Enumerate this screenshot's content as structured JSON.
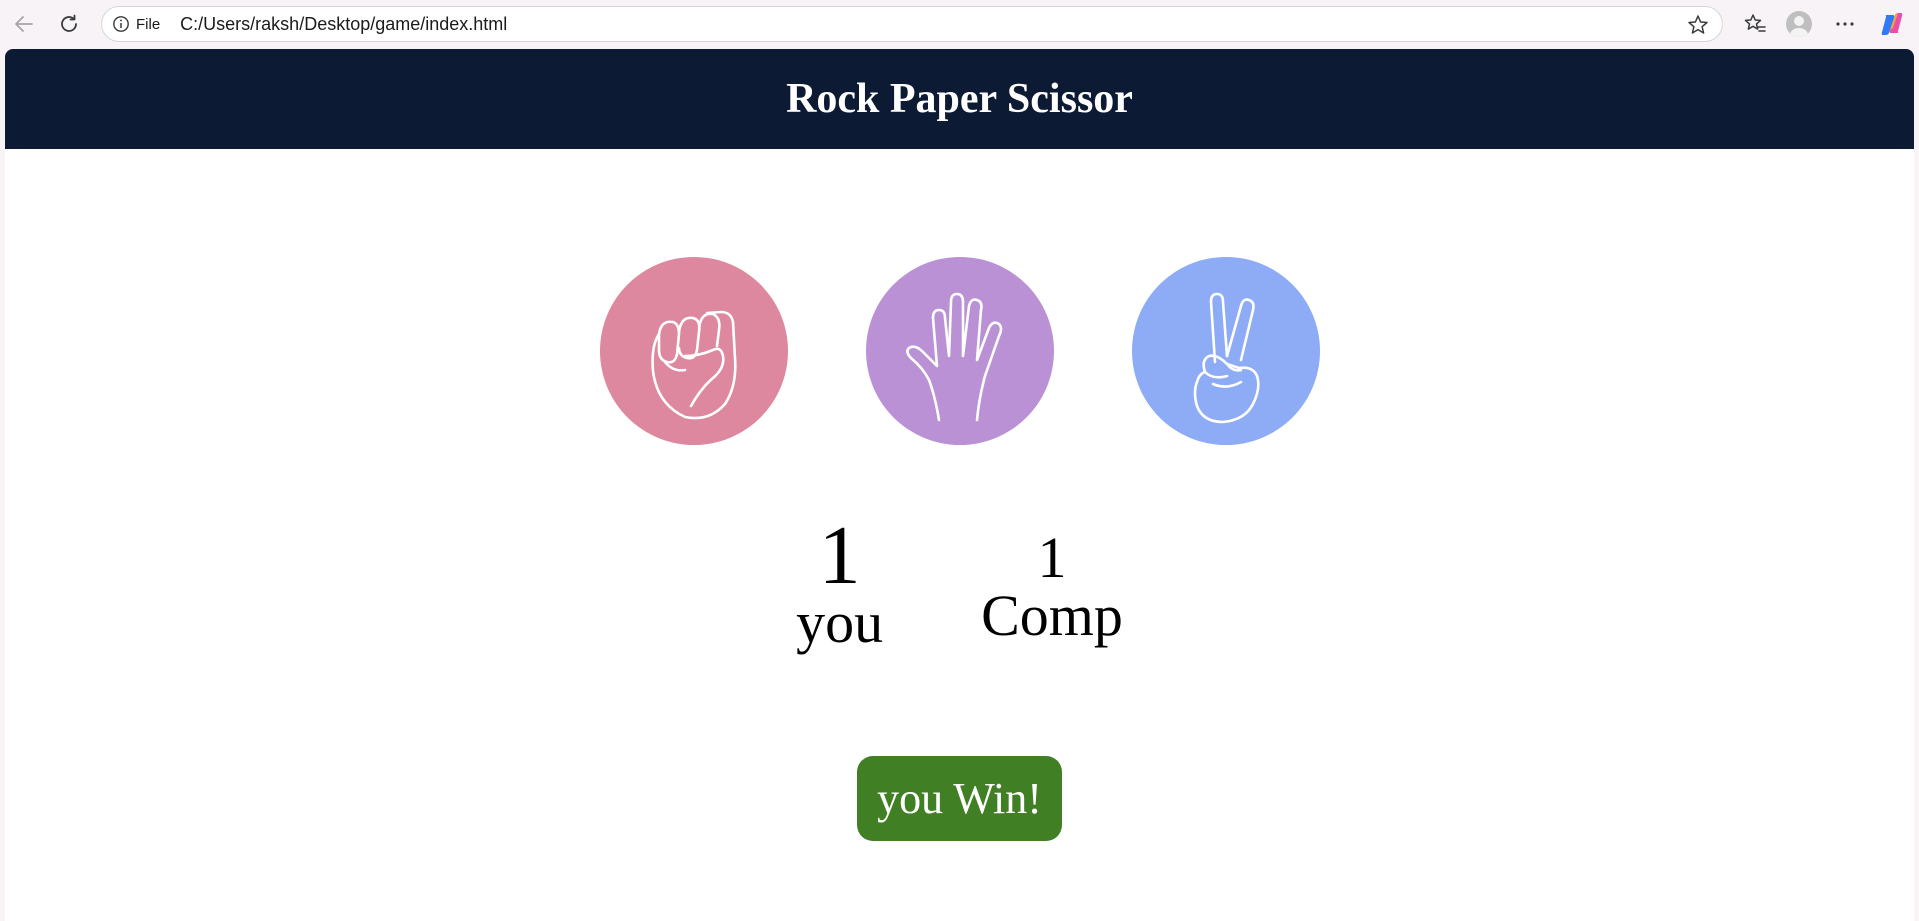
{
  "browser": {
    "file_label": "File",
    "url": "C:/Users/raksh/Desktop/game/index.html",
    "icons": {
      "back": "back-arrow-icon",
      "reload": "reload-icon",
      "info": "info-icon",
      "favorite": "star-icon",
      "favorites_list": "favorites-icon",
      "profile": "profile-icon",
      "more": "more-icon",
      "copilot": "copilot-icon"
    }
  },
  "page": {
    "title": "Rock Paper Scissor",
    "choices": [
      {
        "id": "rock",
        "icon": "rock-fist-icon",
        "color": "#dd889e"
      },
      {
        "id": "paper",
        "icon": "paper-hand-icon",
        "color": "#bb91d6"
      },
      {
        "id": "scissors",
        "icon": "scissors-hand-icon",
        "color": "#8eabf6"
      }
    ],
    "scores": {
      "user": {
        "value": "1",
        "label": "you"
      },
      "computer": {
        "value": "1",
        "label": "Comp"
      }
    },
    "message": {
      "text": "you Win!",
      "color": "#417f24"
    },
    "header_color": "#0c1a33"
  }
}
